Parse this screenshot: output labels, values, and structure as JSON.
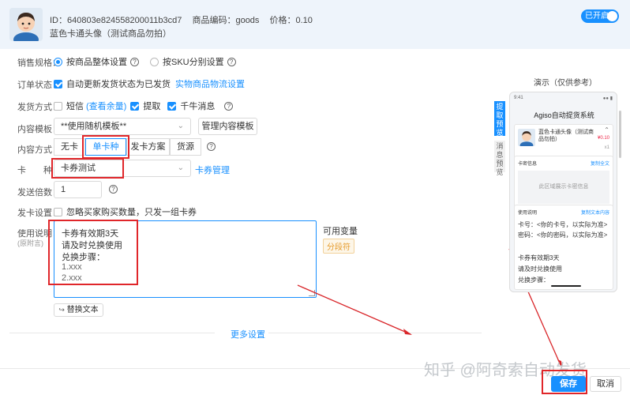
{
  "header": {
    "id_text": "ID：640803e824558200011b3cd7",
    "code_text": "商品编码：goods",
    "price_text": "价格：0.10",
    "product_name": "蓝色卡通头像（测试商品勿拍）",
    "toggle_label": "已开启"
  },
  "form": {
    "spec": {
      "label": "销售规格：",
      "option1": "按商品整体设置",
      "option2": "按SKU分别设置"
    },
    "order_status": {
      "label": "订单状态：",
      "checkbox_label": "自动更新发货状态为已发货",
      "link": "实物商品物流设置"
    },
    "delivery": {
      "label": "发货方式：",
      "sms": "短信",
      "sms_link": "(查看余量)",
      "pickup": "提取",
      "qianniu": "千牛消息"
    },
    "template": {
      "label": "内容模板：",
      "value": "**使用随机模板**",
      "manage_button": "管理内容模板"
    },
    "content_mode": {
      "label": "内容方式：",
      "options": [
        "无卡",
        "单卡种",
        "发卡方案",
        "货源"
      ]
    },
    "card_type": {
      "label": "卡　　种：",
      "value": "卡券测试",
      "manage_link": "卡券管理"
    },
    "multiple": {
      "label": "发送倍数：",
      "value": "1"
    },
    "card_setting": {
      "label": "发卡设置：",
      "checkbox_label": "忽略买家购买数量，只发一组卡券"
    },
    "usage": {
      "label": "使用说明：",
      "sublabel": "(原附言)",
      "lines": [
        "卡券有效期3天",
        "请及时兑换使用",
        "兑换步骤：",
        "1.xxx",
        "2.xxx"
      ],
      "vars_label": "可用变量",
      "segment_tag": "分段符",
      "replace_button": "替换文本"
    },
    "more_settings": "更多设置"
  },
  "preview": {
    "title": "演示（仅供参考）",
    "tab1": "提取预览",
    "tab2": "消息预览",
    "status_time": "9:41",
    "app_title": "Agiso自动提货系统",
    "product_name": "蓝色卡通头像（测试商品勿拍）",
    "price": "¥0.10",
    "qty": "x1",
    "card_info_label": "卡密信息",
    "copy_text": "复制全文",
    "card_area_text": "此区域展示卡密信息",
    "usage_label": "使用说明",
    "copy_usage": "复制文本内容",
    "lines": [
      "卡号：<你的卡号，以实际为准>密码：<你的密码，以实际为准>",
      "卡券有效期3天",
      "请及时兑换使用",
      "兑换步骤："
    ]
  },
  "footer": {
    "save": "保存",
    "cancel": "取消",
    "watermark": "知乎 @阿奇索自动发货"
  }
}
